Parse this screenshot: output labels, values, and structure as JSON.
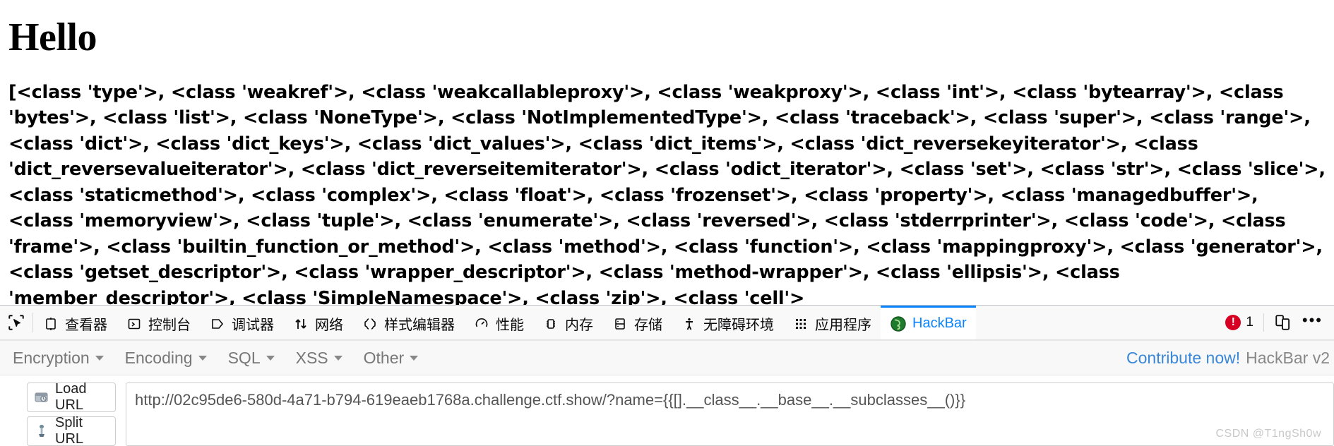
{
  "page": {
    "heading": "Hello",
    "subclasses_dump": "[<class 'type'>, <class 'weakref'>, <class 'weakcallableproxy'>, <class 'weakproxy'>, <class 'int'>, <class 'bytearray'>, <class 'bytes'>, <class 'list'>, <class 'NoneType'>, <class 'NotImplementedType'>, <class 'traceback'>, <class 'super'>, <class 'range'>, <class 'dict'>, <class 'dict_keys'>, <class 'dict_values'>, <class 'dict_items'>, <class 'dict_reversekeyiterator'>, <class 'dict_reversevalueiterator'>, <class 'dict_reverseitemiterator'>, <class 'odict_iterator'>, <class 'set'>, <class 'str'>, <class 'slice'>, <class 'staticmethod'>, <class 'complex'>, <class 'float'>, <class 'frozenset'>, <class 'property'>, <class 'managedbuffer'>, <class 'memoryview'>, <class 'tuple'>, <class 'enumerate'>, <class 'reversed'>, <class 'stderrprinter'>, <class 'code'>, <class 'frame'>, <class 'builtin_function_or_method'>, <class 'method'>, <class 'function'>, <class 'mappingproxy'>, <class 'generator'>, <class 'getset_descriptor'>, <class 'wrapper_descriptor'>, <class 'method-wrapper'>, <class 'ellipsis'>, <class 'member_descriptor'>, <class 'SimpleNamespace'>, <class 'zip'>, <class 'cell'>"
  },
  "devtools": {
    "picker_icon": "element-picker-icon",
    "tabs": [
      {
        "label": "查看器",
        "icon": "inspector-icon",
        "active": false
      },
      {
        "label": "控制台",
        "icon": "console-icon",
        "active": false
      },
      {
        "label": "调试器",
        "icon": "debugger-icon",
        "active": false
      },
      {
        "label": "网络",
        "icon": "network-icon",
        "active": false
      },
      {
        "label": "样式编辑器",
        "icon": "style-editor-icon",
        "active": false
      },
      {
        "label": "性能",
        "icon": "performance-icon",
        "active": false
      },
      {
        "label": "内存",
        "icon": "memory-icon",
        "active": false
      },
      {
        "label": "存储",
        "icon": "storage-icon",
        "active": false
      },
      {
        "label": "无障碍环境",
        "icon": "accessibility-icon",
        "active": false
      },
      {
        "label": "应用程序",
        "icon": "application-icon",
        "active": false
      },
      {
        "label": "HackBar",
        "icon": "hackbar-icon",
        "active": true
      }
    ],
    "error_count": "1",
    "responsive_mode_icon": "responsive-design-mode-icon",
    "more_menu_icon": "meatballs-menu-icon",
    "accent_color": "#0a84ff",
    "error_color": "#d70022"
  },
  "hackbar": {
    "menu": [
      {
        "label": "Encryption"
      },
      {
        "label": "Encoding"
      },
      {
        "label": "SQL"
      },
      {
        "label": "XSS"
      },
      {
        "label": "Other"
      }
    ],
    "contribute_label": "Contribute now!",
    "version_label": "HackBar v2",
    "buttons": [
      {
        "label": "Load URL",
        "icon": "load-url-icon"
      },
      {
        "label": "Split URL",
        "icon": "split-url-icon"
      }
    ],
    "url_value": "http://02c95de6-580d-4a71-b794-619eaeb1768a.challenge.ctf.show/?name={{[].__class__.__base__.__subclasses__()}}",
    "url_placeholder": ""
  },
  "watermark": {
    "text": "CSDN @T1ngSh0w"
  }
}
